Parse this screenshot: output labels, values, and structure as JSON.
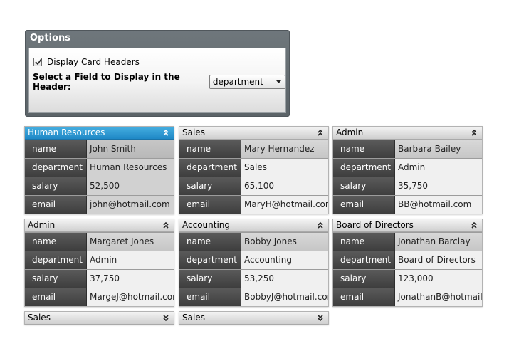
{
  "options": {
    "title": "Options",
    "checkbox_label": "Display Card Headers",
    "checkbox_checked": true,
    "field_label": "Select a Field to Display in the Header:",
    "field_value": "department"
  },
  "row_labels": {
    "name": "name",
    "department": "department",
    "salary": "salary",
    "email": "email"
  },
  "cards": [
    {
      "header": "Human Resources",
      "name": "John Smith",
      "department": "Human Resources",
      "salary": "52,500",
      "email": "john@hotmail.com",
      "selected": true
    },
    {
      "header": "Sales",
      "name": "Mary Hernandez",
      "department": "Sales",
      "salary": "65,100",
      "email": "MaryH@hotmail.com"
    },
    {
      "header": "Admin",
      "name": "Barbara Bailey",
      "department": "Admin",
      "salary": "35,750",
      "email": "BB@hotmail.com"
    },
    {
      "header": "Admin",
      "name": "Margaret Jones",
      "department": "Admin",
      "salary": "37,750",
      "email": "MargeJ@hotmail.com"
    },
    {
      "header": "Accounting",
      "name": "Bobby Jones",
      "department": "Accounting",
      "salary": "53,250",
      "email": "BobbyJ@hotmail.com"
    },
    {
      "header": "Board of Directors",
      "name": "Jonathan Barclay",
      "department": "Board of Directors",
      "salary": "123,000",
      "email": "JonathanB@hotmail.com"
    }
  ],
  "collapsed_cards": [
    {
      "header": "Sales"
    },
    {
      "header": "Sales"
    }
  ],
  "colors": {
    "selected_header": "#2a96d2",
    "label_cell": "#4a4a4a",
    "options_frame": "#646c71"
  },
  "icons": {
    "expanded": "chevron-double-up-icon",
    "collapsed": "chevron-double-down-icon",
    "dropdown": "caret-down-icon",
    "check": "check-icon"
  }
}
